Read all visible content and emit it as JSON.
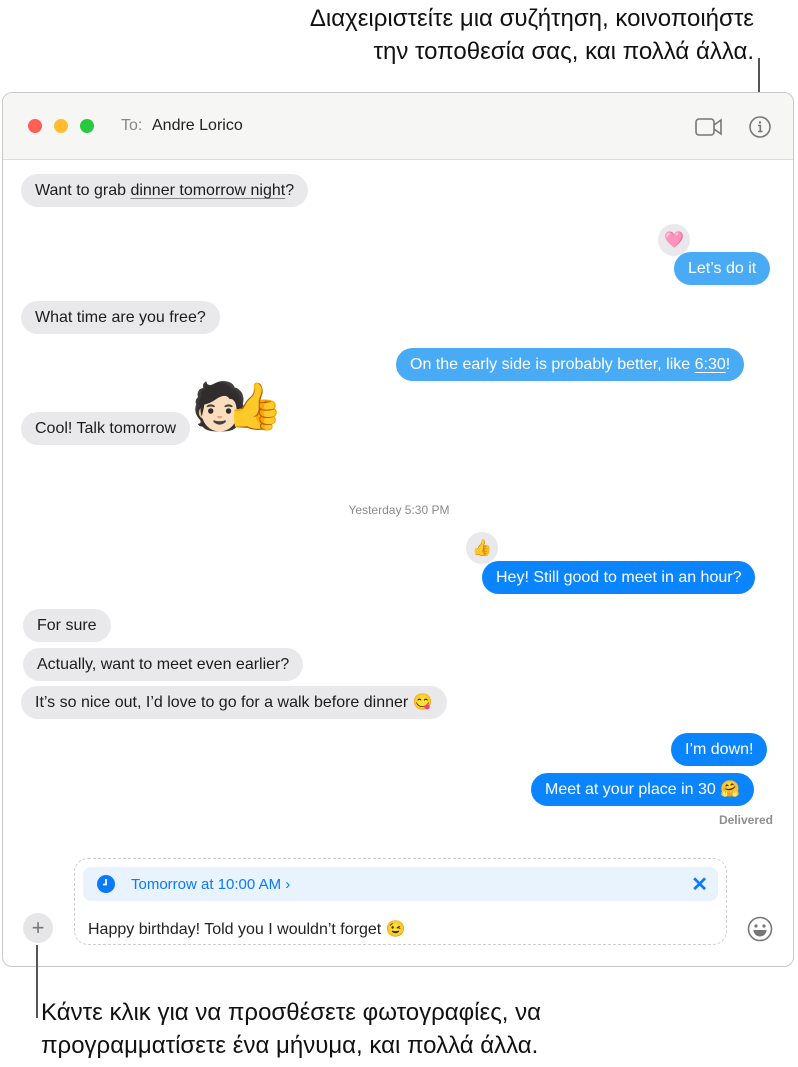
{
  "callouts": {
    "top": [
      "Διαχειριστείτε μια συζήτηση, κοινοποιήστε",
      "την τοποθεσία σας, και πολλά άλλα."
    ],
    "bottom": [
      "Κάντε κλικ για να προσθέσετε φωτογραφίες, να",
      "προγραμματίσετε ένα μήνυμα, και πολλά άλλα."
    ]
  },
  "header": {
    "to_label": "To:",
    "recipient": "Andre Lorico"
  },
  "messages": {
    "m1_pre": "Want to grab ",
    "m1_link": "dinner tomorrow night",
    "m1_post": "?",
    "m2": "Let’s do it",
    "m2_tapback": "🩷",
    "m3": "What time are you free?",
    "m4_pre": "On the early side is probably better, like ",
    "m4_link": "6:30",
    "m4_post": "!",
    "m5": "Cool! Talk tomorrow",
    "memoji": "🧑🏻👍",
    "timestamp": "Yesterday 5:30 PM",
    "m6": "Hey! Still good to meet in an hour?",
    "m6_tapback": "👍",
    "m7": "For sure",
    "m8": "Actually, want to meet even earlier?",
    "m9": "It’s so nice out, I’d love to go for a walk before dinner 😋",
    "m10": "I’m down!",
    "m11": "Meet at your place in 30 🤗",
    "status": "Delivered"
  },
  "compose": {
    "schedule": "Tomorrow at 10:00 AM ›",
    "text": "Happy birthday! Told you I wouldn’t forget 😉"
  },
  "colors": {
    "sent": "#0a84ff",
    "received": "#e9e9eb",
    "schedule_bg": "#e8f3fe"
  }
}
